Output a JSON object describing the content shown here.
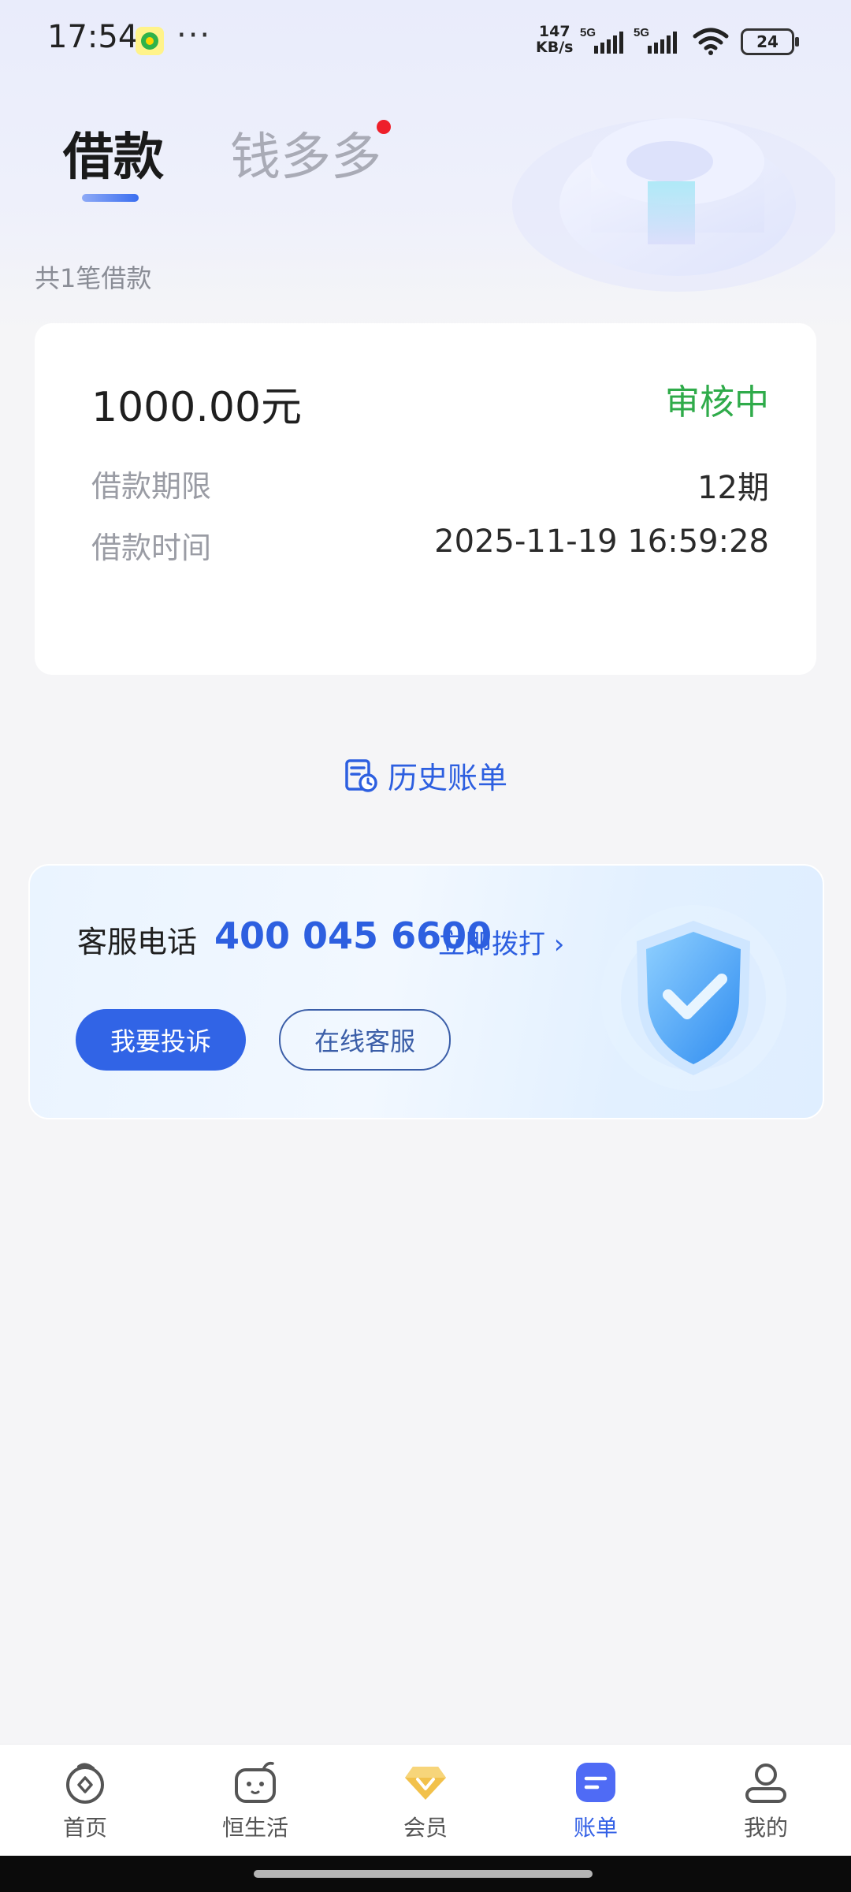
{
  "status_bar": {
    "time": "17:54",
    "more": "···",
    "net_speed_value": "147",
    "net_speed_unit": "KB/s",
    "sim1": "5G",
    "sim2": "5G",
    "battery": "24"
  },
  "tabs": [
    {
      "label": "借款",
      "active": true
    },
    {
      "label": "钱多多",
      "active": false,
      "badge": true
    }
  ],
  "loan_count_text": "共1笔借款",
  "loan": {
    "amount": "1000.00元",
    "status": "审核中",
    "term_label": "借款期限",
    "term_value": "12期",
    "time_label": "借款时间",
    "time_value": "2025-11-19 16:59:28"
  },
  "history_label": "历史账单",
  "service": {
    "label": "客服电话",
    "phone": "400 045 6600",
    "call_label": "立即拨打 ›",
    "complain_button": "我要投诉",
    "online_button": "在线客服"
  },
  "bottom_nav": [
    {
      "label": "首页",
      "icon": "home-icon"
    },
    {
      "label": "恒生活",
      "icon": "life-icon"
    },
    {
      "label": "会员",
      "icon": "vip-diamond-icon"
    },
    {
      "label": "账单",
      "icon": "bill-icon",
      "active": true
    },
    {
      "label": "我的",
      "icon": "profile-icon"
    }
  ],
  "colors": {
    "accent": "#3164e6",
    "status_green": "#2fab4a",
    "badge_red": "#ee1f2a"
  }
}
